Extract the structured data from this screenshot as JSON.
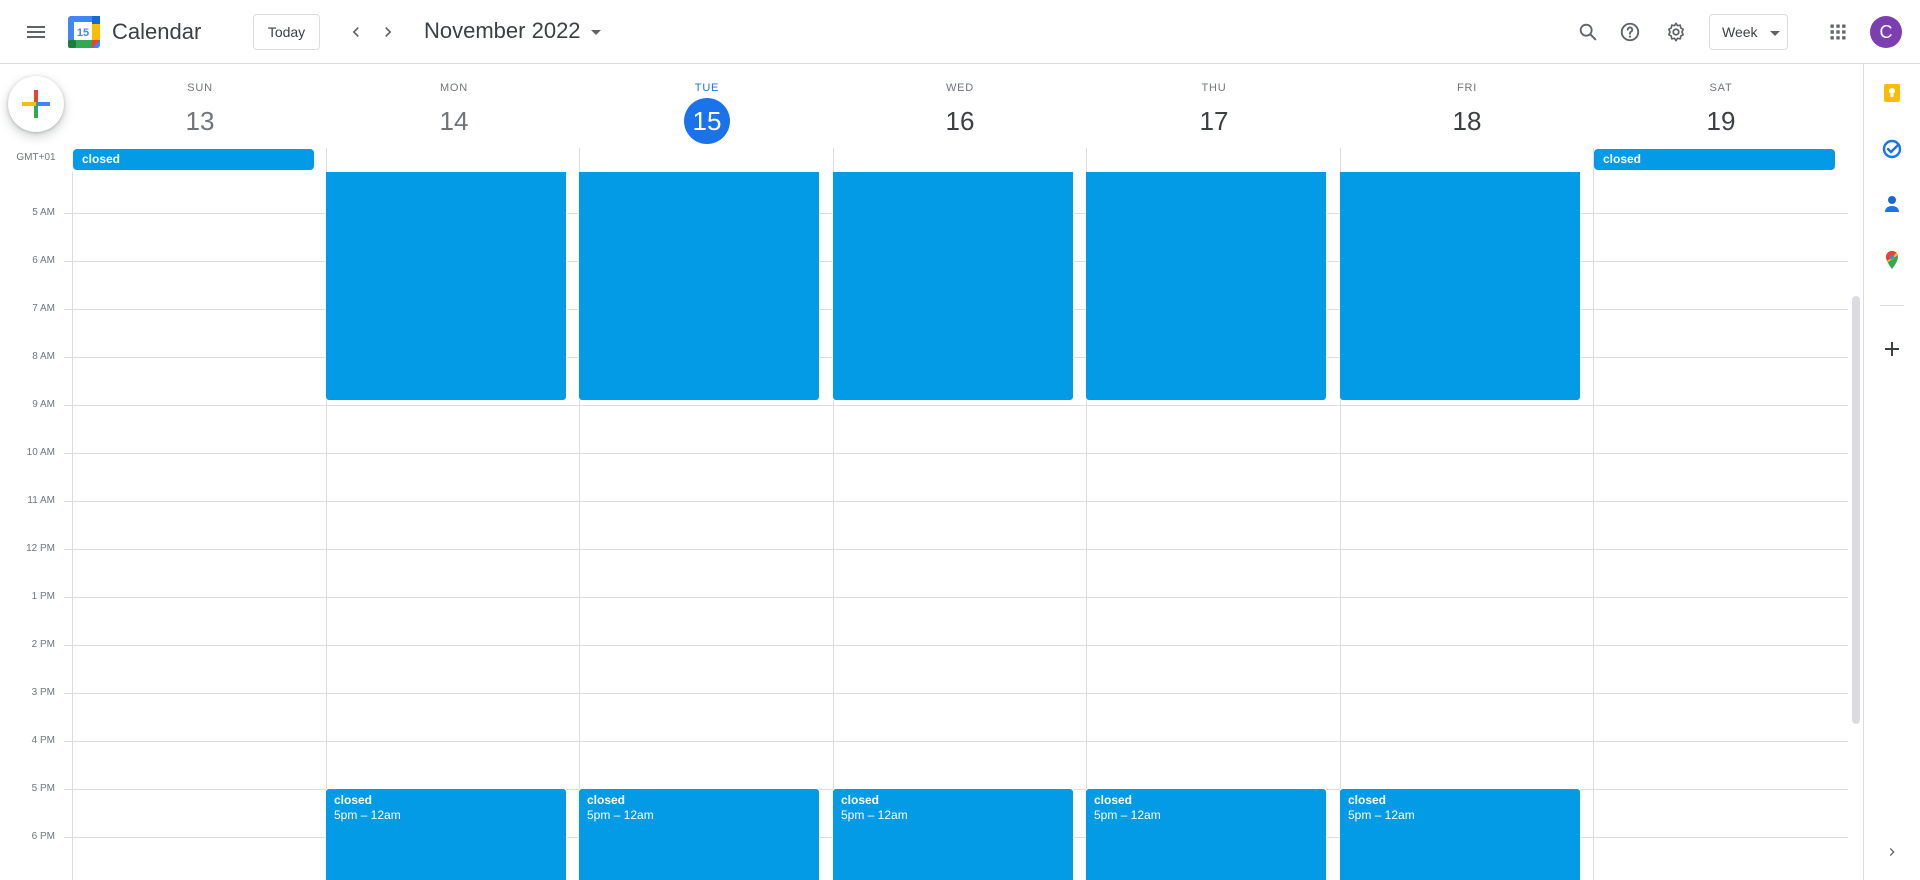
{
  "header": {
    "app_title": "Calendar",
    "logo_number": "15",
    "today_label": "Today",
    "month_title": "November 2022",
    "view_label": "Week",
    "avatar_initial": "C"
  },
  "timezone_label": "GMT+01",
  "days": [
    {
      "dow": "SUN",
      "num": "13"
    },
    {
      "dow": "MON",
      "num": "14"
    },
    {
      "dow": "TUE",
      "num": "15"
    },
    {
      "dow": "WED",
      "num": "16"
    },
    {
      "dow": "THU",
      "num": "17"
    },
    {
      "dow": "FRI",
      "num": "18"
    },
    {
      "dow": "SAT",
      "num": "19"
    }
  ],
  "hours": [
    "5 AM",
    "6 AM",
    "7 AM",
    "8 AM",
    "9 AM",
    "10 AM",
    "11 AM",
    "12 PM",
    "1 PM",
    "2 PM",
    "3 PM",
    "4 PM",
    "5 PM",
    "6 PM"
  ],
  "allday_events": [
    {
      "title": "closed"
    },
    {
      "title": "closed"
    }
  ],
  "morning_events": [
    {
      "title": ""
    },
    {
      "title": ""
    },
    {
      "title": ""
    },
    {
      "title": ""
    },
    {
      "title": ""
    }
  ],
  "evening_events": [
    {
      "title": "closed",
      "time": "5pm – 12am"
    },
    {
      "title": "closed",
      "time": "5pm – 12am"
    },
    {
      "title": "closed",
      "time": "5pm – 12am"
    },
    {
      "title": "closed",
      "time": "5pm – 12am"
    },
    {
      "title": "closed",
      "time": "5pm – 12am"
    }
  ],
  "colors": {
    "event": "#039be5",
    "today": "#1a73e8",
    "avatar": "#7b3fb0"
  },
  "side_panel": [
    "keep-icon",
    "tasks-icon",
    "contacts-icon",
    "maps-icon",
    "add-icon",
    "chevron-right-icon"
  ]
}
